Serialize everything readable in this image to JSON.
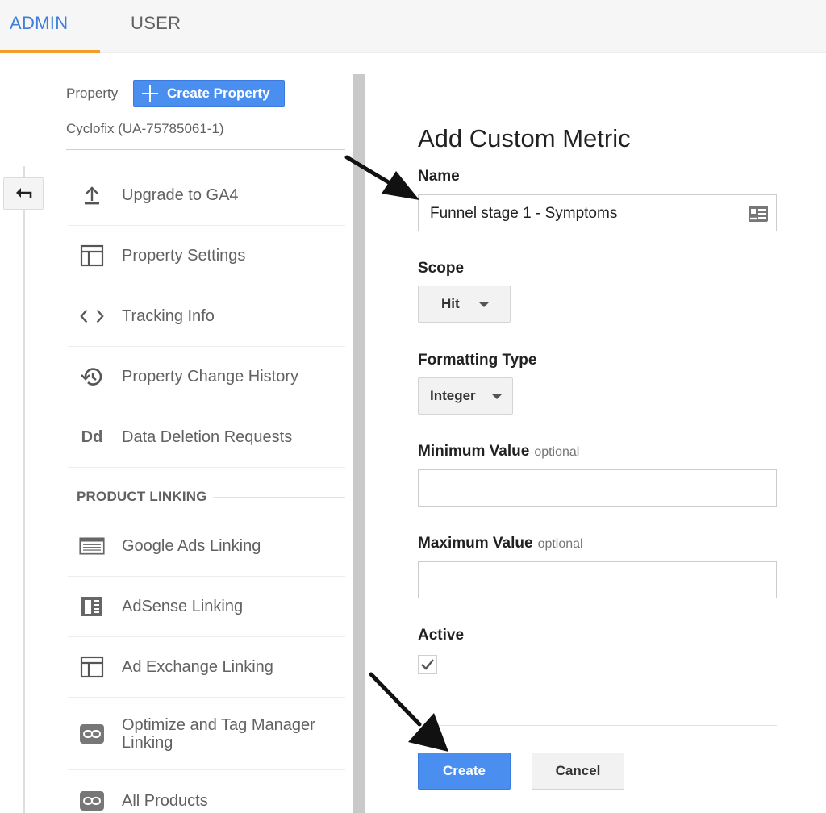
{
  "tabs": {
    "admin": "ADMIN",
    "user": "USER"
  },
  "sidebar": {
    "property_label": "Property",
    "create_property_label": "Create Property",
    "selected_property": "Cyclofix (UA-75785061-1)",
    "items": [
      {
        "label": "Upgrade to GA4",
        "icon": "upload-icon"
      },
      {
        "label": "Property Settings",
        "icon": "layout-icon"
      },
      {
        "label": "Tracking Info",
        "icon": "code-icon"
      },
      {
        "label": "Property Change History",
        "icon": "history-icon"
      },
      {
        "label": "Data Deletion Requests",
        "icon": "data-deletion-icon"
      }
    ],
    "section_header": "PRODUCT LINKING",
    "linking_items": [
      {
        "label": "Google Ads Linking",
        "icon": "ads-icon"
      },
      {
        "label": "AdSense Linking",
        "icon": "adsense-icon"
      },
      {
        "label": "Ad Exchange Linking",
        "icon": "layout-icon"
      },
      {
        "label": "Optimize and Tag Manager Linking",
        "icon": "link-icon"
      },
      {
        "label": "All Products",
        "icon": "link-icon"
      }
    ],
    "data_deletion_glyph": "Dd"
  },
  "form": {
    "title": "Add Custom Metric",
    "name_label": "Name",
    "name_value": "Funnel stage 1 - Symptoms",
    "scope_label": "Scope",
    "scope_value": "Hit",
    "formatting_label": "Formatting Type",
    "formatting_value": "Integer",
    "min_label": "Minimum Value",
    "max_label": "Maximum Value",
    "optional_text": "optional",
    "active_label": "Active",
    "active_checked": true,
    "create_label": "Create",
    "cancel_label": "Cancel"
  },
  "colors": {
    "accent_blue": "#4a8ff0",
    "tab_active": "#3f7fd8",
    "tab_underline": "#f39c27"
  }
}
